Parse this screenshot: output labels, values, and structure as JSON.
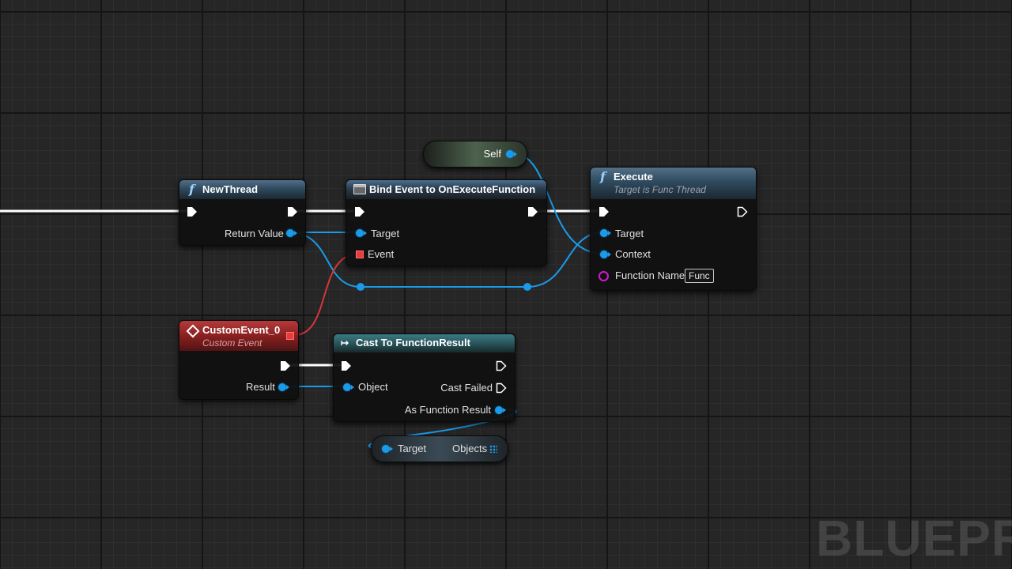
{
  "watermark": "BLUEPRIN",
  "nodes": {
    "new_thread": {
      "title": "NewThread",
      "icon": "function-icon",
      "pins": {
        "return_value": "Return Value"
      }
    },
    "bind_event": {
      "title": "Bind Event to OnExecuteFunction",
      "icon": "delegate-icon",
      "pins": {
        "target": "Target",
        "event": "Event"
      }
    },
    "self": {
      "label": "Self"
    },
    "execute": {
      "title": "Execute",
      "subtitle": "Target is Func Thread",
      "icon": "function-icon",
      "pins": {
        "target": "Target",
        "context": "Context",
        "function_name": "Function Name",
        "function_name_value": "Func"
      }
    },
    "custom_event": {
      "title": "CustomEvent_0",
      "subtitle": "Custom Event",
      "icon": "event-icon",
      "pins": {
        "result": "Result"
      }
    },
    "cast": {
      "title": "Cast To FunctionResult",
      "icon": "cast-icon",
      "pins": {
        "object": "Object",
        "cast_failed": "Cast Failed",
        "as_function_result": "As Function Result"
      }
    },
    "get_objects": {
      "target": "Target",
      "objects": "Objects"
    }
  },
  "colors": {
    "exec_wire": "#ffffff",
    "object_wire": "#1a9bea",
    "delegate_wire": "#e83b3b",
    "name_pin": "#d21aca"
  }
}
